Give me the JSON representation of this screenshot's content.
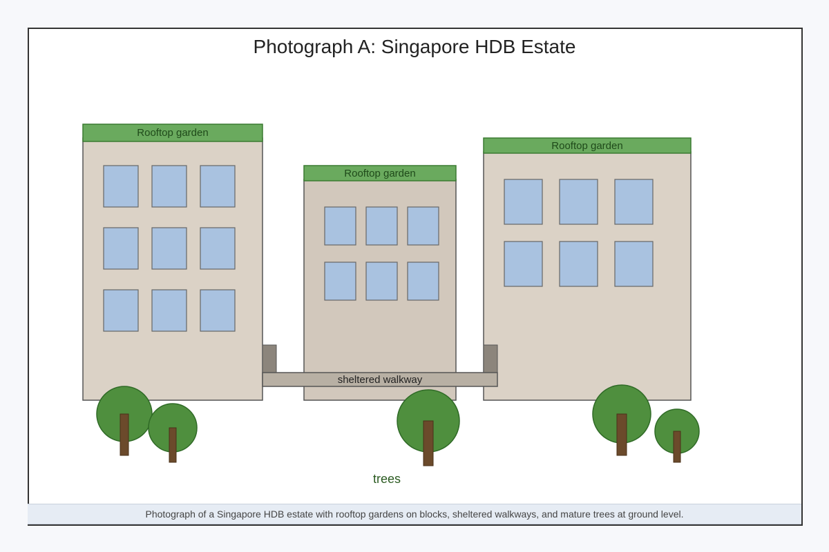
{
  "figure": {
    "title": "Photograph A: Singapore HDB Estate",
    "caption": "Photograph of a Singapore HDB estate with rooftop gardens on blocks, sheltered walkways, and mature trees at ground level."
  },
  "labels": {
    "rooftop_garden_left": "Rooftop garden",
    "rooftop_garden_middle": "Rooftop garden",
    "rooftop_garden_right": "Rooftop garden",
    "walkway": "sheltered walkway",
    "trees": "trees"
  },
  "colors": {
    "building_fill": "#dbd2c6",
    "building_fill_middle": "#d2c8bc",
    "building_stroke": "#555555",
    "window_fill": "#a9c2e0",
    "window_stroke": "#666666",
    "roof_garden_fill": "#6aaa5e",
    "roof_garden_stroke": "#3a7a30",
    "roof_garden_text": "#1f4a1a",
    "walkway_fill": "#b8b0a4",
    "walkway_post_fill": "#8c857c",
    "tree_canopy": "#4f8f3e",
    "tree_canopy_stroke": "#2f6a26",
    "tree_trunk": "#6b4a2b",
    "trees_label": "#2a5a20"
  }
}
